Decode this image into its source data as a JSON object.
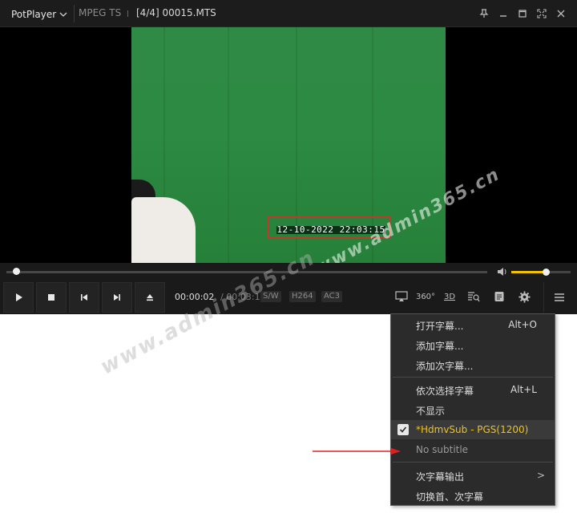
{
  "titlebar": {
    "app_name": "PotPlayer",
    "format": "MPEG TS",
    "file": "[4/4] 00015.MTS"
  },
  "video": {
    "timestamp": "12-10-2022 22:03:15",
    "highlight_color": "#c0392b",
    "green_screen_color": "#2c8a42"
  },
  "watermarks": [
    "www.admin365.cn",
    "www.admin365.cn"
  ],
  "seek": {
    "position_fraction": 0.02
  },
  "volume": {
    "level_fraction": 0.58,
    "fill_color": "#f2c200"
  },
  "controls": {
    "time_current": "00:00:02",
    "time_total": "/ 00:03:16",
    "tags": [
      "S/W",
      "H264",
      "AC3"
    ],
    "icons": [
      "play-icon",
      "stop-icon",
      "previous-icon",
      "next-icon",
      "eject-icon",
      "airplay-icon",
      "360-icon",
      "3d-icon",
      "playlist-search-icon",
      "subtitle-icon",
      "settings-icon",
      "menu-icon"
    ],
    "label_360": "360°",
    "label_3d": "3D"
  },
  "context_menu": {
    "items": [
      {
        "label": "打开字幕...",
        "shortcut": "Alt+O"
      },
      {
        "label": "添加字幕..."
      },
      {
        "label": "添加次字幕..."
      },
      {
        "label": "依次选择字幕",
        "shortcut": "Alt+L"
      },
      {
        "label": "不显示"
      },
      {
        "label": "*HdmvSub - PGS(1200)",
        "checked": true
      },
      {
        "label": "No subtitle"
      },
      {
        "label": "次字幕输出",
        "submenu": ">"
      },
      {
        "label": "切换首、次字幕"
      }
    ],
    "selected_color": "#f1c40f"
  },
  "annotation_arrow_color": "#e02020"
}
